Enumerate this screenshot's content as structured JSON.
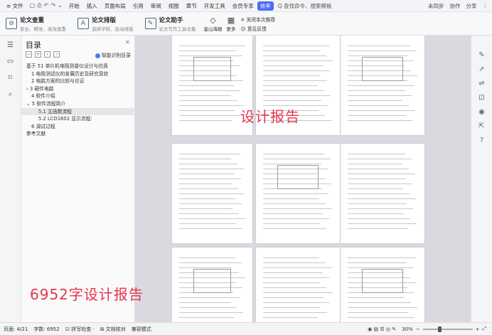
{
  "menubar": {
    "file": "≡ 文件",
    "tabs": [
      "开始",
      "插入",
      "页面布局",
      "引用",
      "审阅",
      "视图",
      "章节",
      "开发工具",
      "会员专享",
      "效率"
    ],
    "active_tab": "效率",
    "search": "Q 查找命令、搜索模板",
    "right": [
      "未同步",
      "协作",
      "分享"
    ]
  },
  "ribbon": {
    "check": {
      "title": "论文查重",
      "sub": "安全、精准、高效查重"
    },
    "format": {
      "title": "论文排版",
      "sub": "选择学校、自动排版"
    },
    "assist": {
      "title": "论文助手",
      "sub": "论文写作工具合集"
    },
    "jinshan": "金山海报",
    "more": "更多",
    "close_rec": "关闭本次推荐",
    "feedback": "意见反馈"
  },
  "toc": {
    "title": "目录",
    "smart": "智能识别目录",
    "items": [
      {
        "label": "基于 51 单片机电阻测量仪设计与仿真",
        "level": "l1c",
        "selected": false
      },
      {
        "label": "1 电阻测试仪的发展历史及研究现状",
        "level": "l1",
        "selected": false
      },
      {
        "label": "2 电路方案的比较与论证",
        "level": "l1",
        "selected": false
      },
      {
        "label": "› 3 硬件电路",
        "level": "l1c",
        "selected": false
      },
      {
        "label": "4 软件介绍",
        "level": "l1",
        "selected": false
      },
      {
        "label": "⌄ 5 软件流程简介",
        "level": "l1c",
        "selected": false
      },
      {
        "label": "5.1 主函数流程",
        "level": "l2",
        "selected": true
      },
      {
        "label": "5.2 LCD1602 显示流程:",
        "level": "l2",
        "selected": false
      },
      {
        "label": "6 调试过程",
        "level": "l1",
        "selected": false
      },
      {
        "label": "参考文献",
        "level": "l1c",
        "selected": false
      }
    ]
  },
  "overlay": {
    "center": "设计报告",
    "bottom": "6952字设计报告"
  },
  "status": {
    "page": "页面: 4/21",
    "words": "字数: 6952",
    "spell": "拼写检查 ·",
    "proof": "文档校对",
    "compat": "兼容模式",
    "zoom": "30%",
    "zoom_level": 0.3
  }
}
